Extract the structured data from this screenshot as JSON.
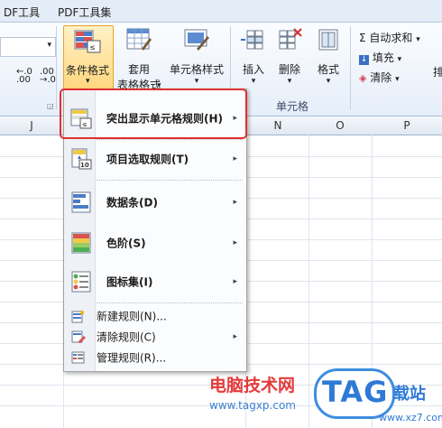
{
  "tabs": [
    "DF工具",
    "PDF工具集"
  ],
  "ribbon": {
    "number_buttons": [
      ".00",
      ".00"
    ],
    "conditional_format": "条件格式",
    "table_style": "套用",
    "table_style_2": "表格格式",
    "cell_style": "单元格样式",
    "insert": "插入",
    "delete": "删除",
    "format": "格式",
    "cells_group": "单元格",
    "autosum": "Σ 自动求和",
    "fill": "填充",
    "clear": "清除",
    "sort_partial": "排"
  },
  "columns": [
    "J",
    "N",
    "O",
    "P"
  ],
  "menu": {
    "items": [
      {
        "label": "突出显示单元格规则(H)",
        "arrow": "▸"
      },
      {
        "label": "项目选取规则(T)",
        "arrow": "▸"
      },
      {
        "label": "数据条(D)",
        "arrow": "▸"
      },
      {
        "label": "色阶(S)",
        "arrow": "▸"
      },
      {
        "label": "图标集(I)",
        "arrow": "▸"
      }
    ],
    "small_items": [
      {
        "label": "新建规则(N)..."
      },
      {
        "label": "清除规则(C)",
        "arrow": "▸"
      },
      {
        "label": "管理规则(R)..."
      }
    ]
  },
  "watermark": {
    "line1": "电脑技术网",
    "line2": "www.tagxp.com",
    "logo": "TAG",
    "side": "载站",
    "url2": "www.xz7.com"
  }
}
